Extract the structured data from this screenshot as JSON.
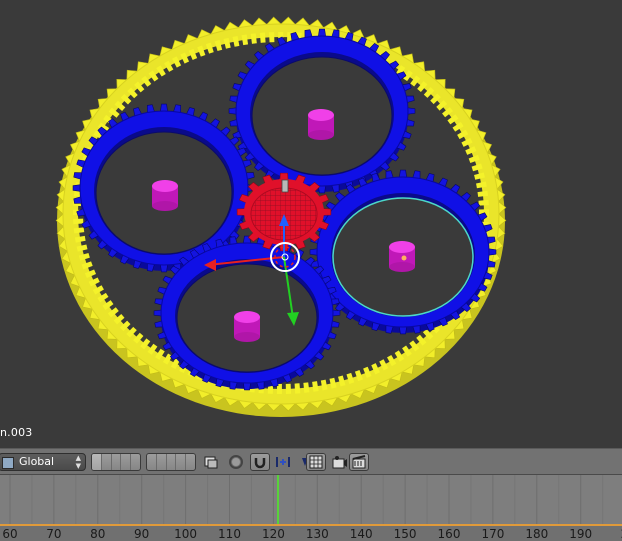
{
  "viewport": {
    "object_name": "n.003",
    "background": "#3a3a3a",
    "ring_gear_color": "#f4f22a",
    "planet_gear_color": "#1010e6",
    "sun_gear_color": "#e0102a",
    "pin_color": "#e81fd8",
    "selected_outline": "#4cd8c8"
  },
  "header": {
    "orientation_label": "Global",
    "icons": [
      "view-icon",
      "layer-grid-1",
      "layer-grid-2",
      "render-icon",
      "shading-icon",
      "snap-magnet-icon",
      "snap-element-icon",
      "snap-target-icon",
      "camera-icon",
      "clapper-icon"
    ]
  },
  "timeline": {
    "ticks": [
      "60",
      "70",
      "80",
      "90",
      "100",
      "110",
      "120",
      "130",
      "140",
      "150",
      "160",
      "170",
      "180",
      "190",
      "2"
    ],
    "current_frame_marker": "#58d23a",
    "range_line": "#e09a3a"
  }
}
